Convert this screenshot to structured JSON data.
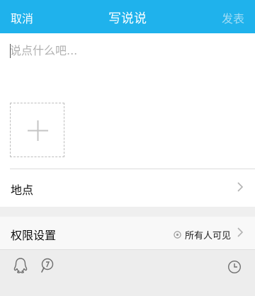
{
  "header": {
    "cancel_label": "取消",
    "title": "写说说",
    "publish_label": "发表"
  },
  "composer": {
    "placeholder": "说点什么吧..."
  },
  "location_row": {
    "label": "地点"
  },
  "permission_row": {
    "label": "权限设置",
    "value": "所有人可见"
  },
  "toolbar": {
    "icons": [
      "qq-icon",
      "mention-icon",
      "clock-icon"
    ]
  },
  "colors": {
    "header_bg": "#1fb2ec",
    "publish_disabled": "#9fdcf5",
    "toolbar_bg": "#ededed"
  }
}
